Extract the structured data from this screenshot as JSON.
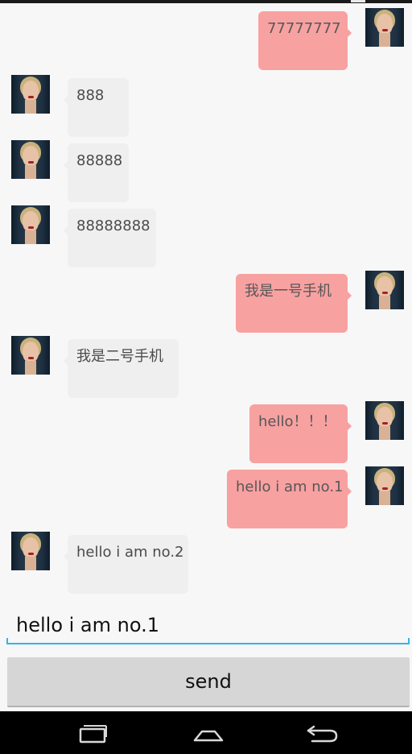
{
  "chat": {
    "messages": [
      {
        "side": "right",
        "text": "77777777"
      },
      {
        "side": "left",
        "text": "888"
      },
      {
        "side": "left",
        "text": "88888"
      },
      {
        "side": "left",
        "text": "88888888"
      },
      {
        "side": "right",
        "text": "我是一号手机"
      },
      {
        "side": "left",
        "text": "我是二号手机"
      },
      {
        "side": "right",
        "text": "hello！！！"
      },
      {
        "side": "right",
        "text": "hello i am no.1"
      },
      {
        "side": "left",
        "text": "hello i am no.2"
      }
    ]
  },
  "input": {
    "value": "hello i am no.1"
  },
  "send": {
    "label": "send"
  },
  "nav": {
    "icons": [
      "recent-apps-icon",
      "home-icon",
      "back-icon"
    ]
  },
  "colors": {
    "outgoing_bubble": "#f8a1a1",
    "incoming_bubble": "#efefef",
    "input_accent": "#33b5e5",
    "send_button": "#d6d6d6",
    "background": "#f7f7f7"
  }
}
